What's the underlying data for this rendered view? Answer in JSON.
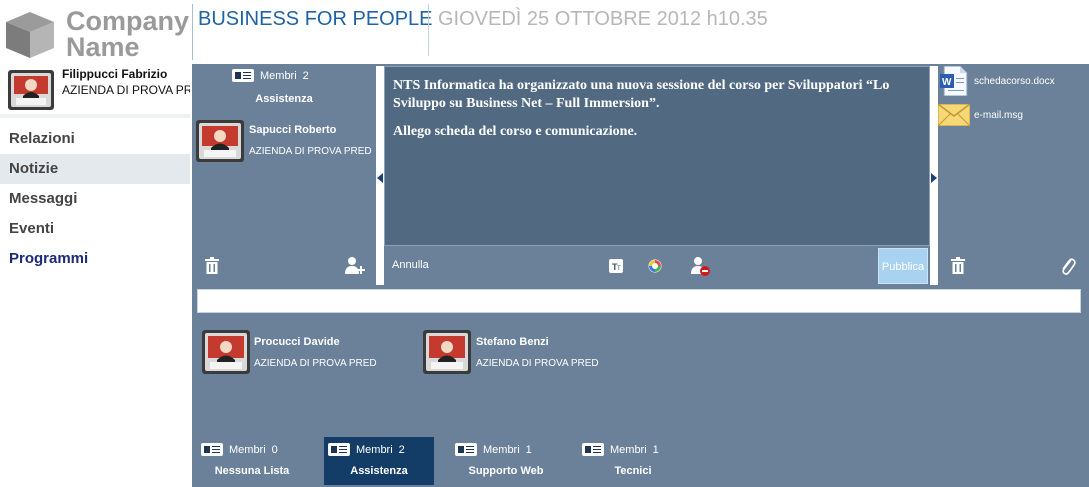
{
  "header": {
    "company_logo_text": "Company Name",
    "title": "BUSINESS FOR PEOPLE",
    "date": "GIOVEDÌ 25 OTTOBRE 2012 h10.35"
  },
  "user": {
    "name": "Filippucci Fabrizio",
    "company": "AZIENDA DI PROVA PR"
  },
  "nav": {
    "items": [
      {
        "label": "Relazioni"
      },
      {
        "label": "Notizie"
      },
      {
        "label": "Messaggi"
      },
      {
        "label": "Eventi"
      },
      {
        "label": "Programmi"
      }
    ],
    "active": "Notizie"
  },
  "group_panel": {
    "members_label": "Membri",
    "members_count": "2",
    "group_name": "Assistenza",
    "contact": {
      "name": "Sapucci Roberto",
      "company": "AZIENDA DI PROVA PRED"
    }
  },
  "editor": {
    "line1": "NTS Informatica ha organizzato una nuova sessione del corso per Sviluppatori “Lo Sviluppo su Business Net – Full Immersion”.",
    "line2": "Allego scheda del corso e comunicazione.",
    "cancel_label": "Annulla",
    "publish_label": "Pubblica"
  },
  "attachments": [
    {
      "name": "schedacorso.docx",
      "icon": "word-doc-icon"
    },
    {
      "name": "e-mail.msg",
      "icon": "envelope-icon"
    }
  ],
  "search": {
    "value": ""
  },
  "members": [
    {
      "name": "Procucci Davide",
      "company": "AZIENDA DI PROVA PRED"
    },
    {
      "name": "Stefano Benzi",
      "company": "AZIENDA DI PROVA PRED"
    }
  ],
  "tabs": [
    {
      "members_label": "Membri",
      "count": "0",
      "name": "Nessuna Lista"
    },
    {
      "members_label": "Membri",
      "count": "2",
      "name": "Assistenza"
    },
    {
      "members_label": "Membri",
      "count": "1",
      "name": "Supporto Web"
    },
    {
      "members_label": "Membri",
      "count": "1",
      "name": "Tecnici"
    }
  ],
  "avatar_caption": "Name",
  "colors": {
    "panel": "#6a8199",
    "editor": "#516a82",
    "active_tab": "#133d66",
    "title_blue": "#1d63a6",
    "publish": "#a9d2f0"
  }
}
